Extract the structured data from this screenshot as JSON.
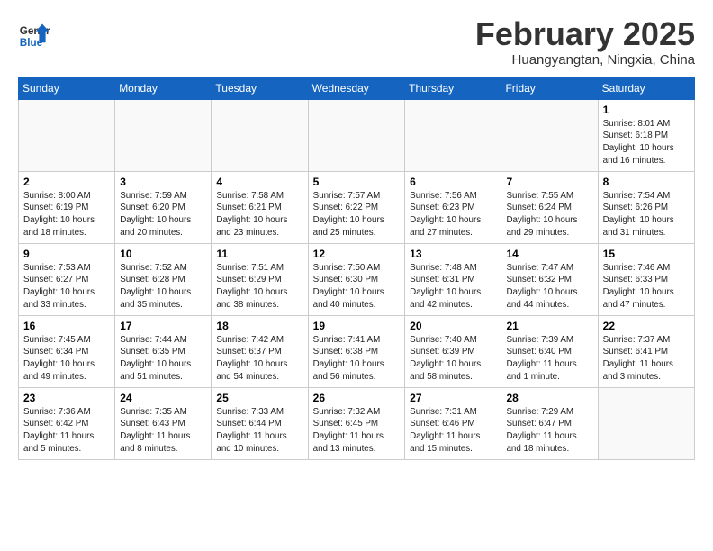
{
  "header": {
    "logo_general": "General",
    "logo_blue": "Blue",
    "month_title": "February 2025",
    "location": "Huangyangtan, Ningxia, China"
  },
  "days_of_week": [
    "Sunday",
    "Monday",
    "Tuesday",
    "Wednesday",
    "Thursday",
    "Friday",
    "Saturday"
  ],
  "weeks": [
    [
      {
        "day": "",
        "info": ""
      },
      {
        "day": "",
        "info": ""
      },
      {
        "day": "",
        "info": ""
      },
      {
        "day": "",
        "info": ""
      },
      {
        "day": "",
        "info": ""
      },
      {
        "day": "",
        "info": ""
      },
      {
        "day": "1",
        "info": "Sunrise: 8:01 AM\nSunset: 6:18 PM\nDaylight: 10 hours\nand 16 minutes."
      }
    ],
    [
      {
        "day": "2",
        "info": "Sunrise: 8:00 AM\nSunset: 6:19 PM\nDaylight: 10 hours\nand 18 minutes."
      },
      {
        "day": "3",
        "info": "Sunrise: 7:59 AM\nSunset: 6:20 PM\nDaylight: 10 hours\nand 20 minutes."
      },
      {
        "day": "4",
        "info": "Sunrise: 7:58 AM\nSunset: 6:21 PM\nDaylight: 10 hours\nand 23 minutes."
      },
      {
        "day": "5",
        "info": "Sunrise: 7:57 AM\nSunset: 6:22 PM\nDaylight: 10 hours\nand 25 minutes."
      },
      {
        "day": "6",
        "info": "Sunrise: 7:56 AM\nSunset: 6:23 PM\nDaylight: 10 hours\nand 27 minutes."
      },
      {
        "day": "7",
        "info": "Sunrise: 7:55 AM\nSunset: 6:24 PM\nDaylight: 10 hours\nand 29 minutes."
      },
      {
        "day": "8",
        "info": "Sunrise: 7:54 AM\nSunset: 6:26 PM\nDaylight: 10 hours\nand 31 minutes."
      }
    ],
    [
      {
        "day": "9",
        "info": "Sunrise: 7:53 AM\nSunset: 6:27 PM\nDaylight: 10 hours\nand 33 minutes."
      },
      {
        "day": "10",
        "info": "Sunrise: 7:52 AM\nSunset: 6:28 PM\nDaylight: 10 hours\nand 35 minutes."
      },
      {
        "day": "11",
        "info": "Sunrise: 7:51 AM\nSunset: 6:29 PM\nDaylight: 10 hours\nand 38 minutes."
      },
      {
        "day": "12",
        "info": "Sunrise: 7:50 AM\nSunset: 6:30 PM\nDaylight: 10 hours\nand 40 minutes."
      },
      {
        "day": "13",
        "info": "Sunrise: 7:48 AM\nSunset: 6:31 PM\nDaylight: 10 hours\nand 42 minutes."
      },
      {
        "day": "14",
        "info": "Sunrise: 7:47 AM\nSunset: 6:32 PM\nDaylight: 10 hours\nand 44 minutes."
      },
      {
        "day": "15",
        "info": "Sunrise: 7:46 AM\nSunset: 6:33 PM\nDaylight: 10 hours\nand 47 minutes."
      }
    ],
    [
      {
        "day": "16",
        "info": "Sunrise: 7:45 AM\nSunset: 6:34 PM\nDaylight: 10 hours\nand 49 minutes."
      },
      {
        "day": "17",
        "info": "Sunrise: 7:44 AM\nSunset: 6:35 PM\nDaylight: 10 hours\nand 51 minutes."
      },
      {
        "day": "18",
        "info": "Sunrise: 7:42 AM\nSunset: 6:37 PM\nDaylight: 10 hours\nand 54 minutes."
      },
      {
        "day": "19",
        "info": "Sunrise: 7:41 AM\nSunset: 6:38 PM\nDaylight: 10 hours\nand 56 minutes."
      },
      {
        "day": "20",
        "info": "Sunrise: 7:40 AM\nSunset: 6:39 PM\nDaylight: 10 hours\nand 58 minutes."
      },
      {
        "day": "21",
        "info": "Sunrise: 7:39 AM\nSunset: 6:40 PM\nDaylight: 11 hours\nand 1 minute."
      },
      {
        "day": "22",
        "info": "Sunrise: 7:37 AM\nSunset: 6:41 PM\nDaylight: 11 hours\nand 3 minutes."
      }
    ],
    [
      {
        "day": "23",
        "info": "Sunrise: 7:36 AM\nSunset: 6:42 PM\nDaylight: 11 hours\nand 5 minutes."
      },
      {
        "day": "24",
        "info": "Sunrise: 7:35 AM\nSunset: 6:43 PM\nDaylight: 11 hours\nand 8 minutes."
      },
      {
        "day": "25",
        "info": "Sunrise: 7:33 AM\nSunset: 6:44 PM\nDaylight: 11 hours\nand 10 minutes."
      },
      {
        "day": "26",
        "info": "Sunrise: 7:32 AM\nSunset: 6:45 PM\nDaylight: 11 hours\nand 13 minutes."
      },
      {
        "day": "27",
        "info": "Sunrise: 7:31 AM\nSunset: 6:46 PM\nDaylight: 11 hours\nand 15 minutes."
      },
      {
        "day": "28",
        "info": "Sunrise: 7:29 AM\nSunset: 6:47 PM\nDaylight: 11 hours\nand 18 minutes."
      },
      {
        "day": "",
        "info": ""
      }
    ]
  ]
}
